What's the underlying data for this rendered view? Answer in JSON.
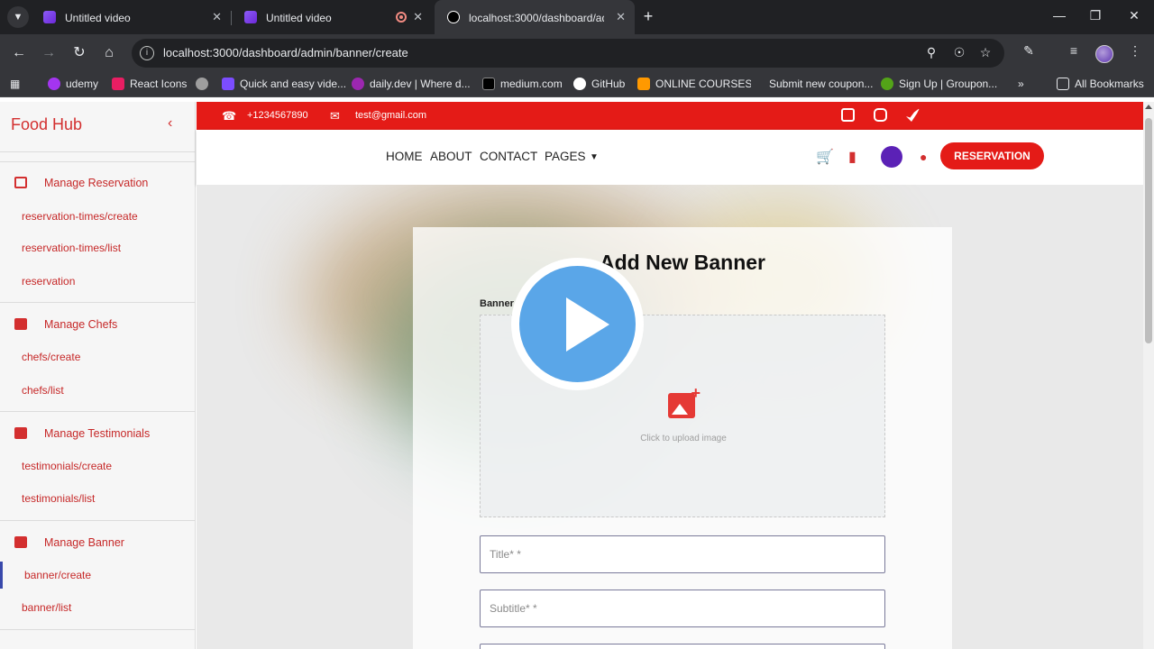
{
  "browser": {
    "tabs": [
      {
        "title": "Untitled video"
      },
      {
        "title": "Untitled video"
      },
      {
        "title": "localhost:3000/dashboard/adm"
      }
    ],
    "url": "localhost:3000/dashboard/admin/banner/create",
    "bookmarks": [
      {
        "label": "udemy",
        "color": "#a435f0"
      },
      {
        "label": "React Icons",
        "color": "#e91e63"
      },
      {
        "label": "",
        "color": "#9e9e9e"
      },
      {
        "label": "Quick and easy vide...",
        "color": "#7c4dff"
      },
      {
        "label": "daily.dev | Where d...",
        "color": "#9c27b0"
      },
      {
        "label": "medium.com",
        "color": "#000000"
      },
      {
        "label": "GitHub",
        "color": "#ffffff"
      },
      {
        "label": "ONLINE COURSES",
        "color": "#ff9900"
      },
      {
        "label": "Submit new coupon...",
        "color": "#35363a"
      },
      {
        "label": "Sign Up | Groupon...",
        "color": "#53a318"
      }
    ],
    "all_bookmarks": "All Bookmarks"
  },
  "sidebar": {
    "brand": "Food Hub",
    "sections": [
      {
        "title": "Manage Reservation",
        "items": [
          "reservation-times/create",
          "reservation-times/list",
          "reservation"
        ]
      },
      {
        "title": "Manage Chefs",
        "items": [
          "chefs/create",
          "chefs/list"
        ]
      },
      {
        "title": "Manage Testimonials",
        "items": [
          "testimonials/create",
          "testimonials/list"
        ]
      },
      {
        "title": "Manage Banner",
        "items": [
          "banner/create",
          "banner/list"
        ]
      }
    ],
    "active_item": "banner/create"
  },
  "topbar": {
    "phone": "+1234567890",
    "email": "test@gmail.com",
    "social": [
      "facebook-icon",
      "instagram-icon",
      "twitter-icon"
    ]
  },
  "navbar": {
    "links": [
      "HOME",
      "ABOUT",
      "CONTACT",
      "PAGES"
    ],
    "reservation_button": "RESERVATION"
  },
  "form": {
    "heading": "Add New Banner",
    "image_label": "Banner",
    "upload_text": "Click to upload image",
    "title_placeholder": "Title* *",
    "subtitle_placeholder": "Subtitle* *"
  },
  "colors": {
    "brand_red": "#e41b17",
    "play_blue": "#5aa6e8",
    "active_indicator": "#3949ab"
  }
}
